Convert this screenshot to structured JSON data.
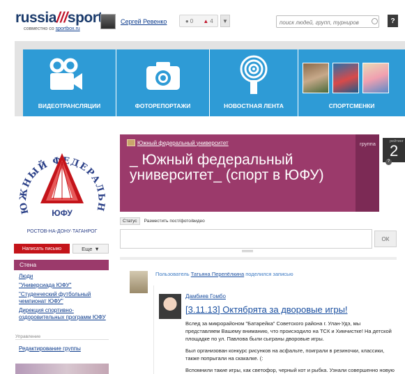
{
  "header": {
    "logo_part1": "russia",
    "logo_part2": "sport",
    "logo_subtitle_prefix": "совместно со",
    "logo_subtitle_link": "sportbox.ru",
    "user_name": "Сергей Ревенко",
    "messages_count": "0",
    "alerts_count": "4",
    "search_placeholder": "поиск людей, групп, турниров",
    "help_label": "?"
  },
  "nav_tiles": [
    {
      "label": "ВИДЕОТРАНСЛЯЦИИ",
      "icon": "video-camera-icon"
    },
    {
      "label": "ФОТОРЕПОРТАЖИ",
      "icon": "photo-camera-icon"
    },
    {
      "label": "НОВОСТНАЯ ЛЕНТА",
      "icon": "broadcast-icon"
    },
    {
      "label": "СПОРТСМЕНКИ",
      "icon": "sportswomen-photos"
    }
  ],
  "sidebar": {
    "write_button": "Написать письмо",
    "more_button": "Еще",
    "wall_label": "Стена",
    "items": [
      "Люди",
      "\"Универсиада ЮФУ\"",
      "\"Студенческий футбольный чемпионат ЮФУ\"",
      "Дирекция спортивно-оздоровительных программ ЮФУ"
    ],
    "section_management": "Управление",
    "edit_group": "Редактирование группы"
  },
  "group": {
    "crumb_link": "Южный федеральный университет",
    "title": "_ Южный федеральный университет_ (спорт в ЮФУ)",
    "type_label": "группа",
    "rating_label": "рейтинг",
    "rating_value": "2",
    "logo_ring_text": "ЮЖНЫЙ ФЕДЕРАЛЬНЫЙ УНИВЕРСИТЕТ",
    "logo_center_text": "ЮФУ",
    "logo_city_text": "РОСТОВ-НА-ДОНУ·ТАГАНРОГ"
  },
  "status": {
    "tab_status": "Статус",
    "tab_post": "Разместить пост/фото/видео",
    "ok_label": "ОК"
  },
  "post": {
    "meta_prefix": "Пользователь",
    "meta_user": "Татьяна Перепёлкина",
    "meta_suffix": "поделился записью",
    "author": "Дамбиев Гомбо",
    "title": "[3.11.13] Октябрята за дворовые игры!",
    "paragraphs": [
      "Вслед за микрорайоном \"Батарейка\" Советского района г. Улан-Удэ, мы представляем Вашему вниманию, что происходило на ТСК и Химчистке! На детской площадке по ул. Павлова были сыграны дворовые игры.",
      "Был организован конкурс рисунков на асфальте, поиграли в резиночки, классики, также попрыгали на скакалке. (:",
      "Вспомнили такие игры, как светофор, черный кот и рыбка. Узнали совершенно новую"
    ]
  },
  "colors": {
    "tile_blue": "#2e9bd6",
    "group_purple": "#9b3a6b",
    "write_red": "#c4141a"
  }
}
